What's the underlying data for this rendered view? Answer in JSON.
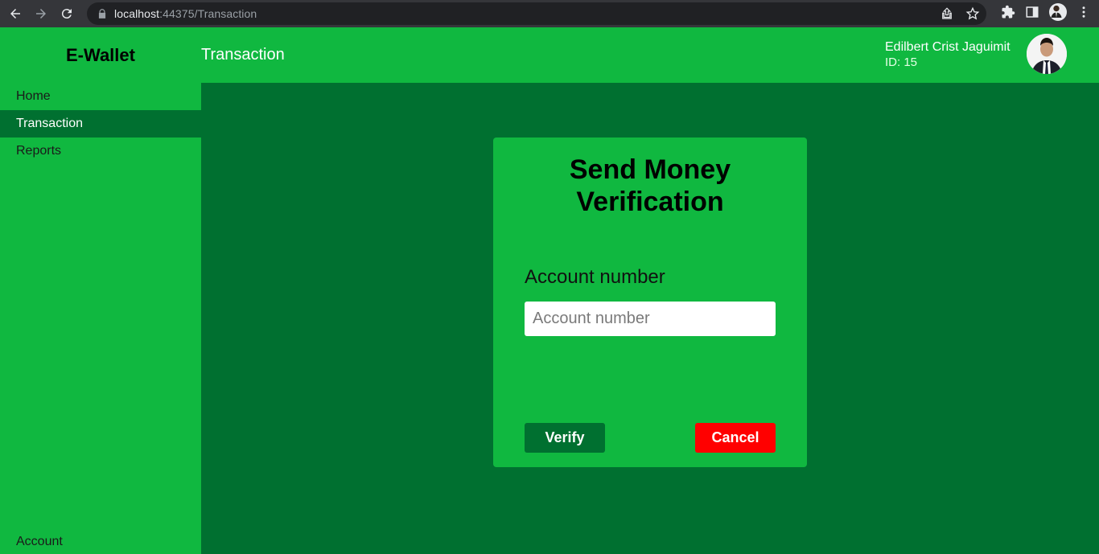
{
  "browser": {
    "url_host": "localhost",
    "url_rest": ":44375/Transaction"
  },
  "header": {
    "brand": "E-Wallet",
    "page_title": "Transaction",
    "user_name": "Edilbert Crist Jaguimit",
    "user_id": "ID: 15"
  },
  "sidebar": {
    "items": [
      {
        "label": "Home"
      },
      {
        "label": "Transaction"
      },
      {
        "label": "Reports"
      }
    ],
    "account_label": "Account"
  },
  "card": {
    "title_line1": "Send Money",
    "title_line2": "Verification",
    "field_label": "Account number",
    "field_placeholder": "Account number",
    "field_value": "",
    "verify_label": "Verify",
    "cancel_label": "Cancel"
  },
  "colors": {
    "accent_green": "#10b840",
    "dark_green": "#007030",
    "cancel_red": "#ff0000"
  }
}
